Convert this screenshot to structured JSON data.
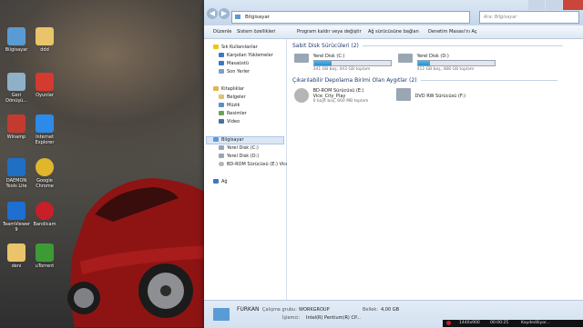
{
  "desktop": {
    "icons": [
      {
        "label": "Bilgisayar",
        "icon": "computer-icon",
        "color": "#5b9bd5"
      },
      {
        "label": "ddd",
        "icon": "folder-icon",
        "color": "#e9c46a"
      },
      {
        "label": "Geri Dönüşü...",
        "icon": "recycle-bin-icon",
        "color": "#8fb0c9"
      },
      {
        "label": "Oyunlar",
        "icon": "games-icon",
        "color": "#d43a2f"
      },
      {
        "label": "Winamp",
        "icon": "winamp-icon",
        "color": "#c53a2f"
      },
      {
        "label": "Internet Explorer",
        "icon": "internet-explorer-icon",
        "color": "#2c8be8"
      },
      {
        "label": "DAEMON Tools Lite",
        "icon": "daemon-tools-icon",
        "color": "#1f6fc4"
      },
      {
        "label": "Google Chrome",
        "icon": "chrome-icon",
        "color": "#e0b62d"
      },
      {
        "label": "TeamViewer 9",
        "icon": "teamviewer-icon",
        "color": "#1d6fd1"
      },
      {
        "label": "Bandicam",
        "icon": "bandicam-icon",
        "color": "#c81f2a"
      },
      {
        "label": "deni",
        "icon": "folder-icon",
        "color": "#e9c46a"
      },
      {
        "label": "uTorrent",
        "icon": "utorrent-icon",
        "color": "#3d9b35"
      }
    ]
  },
  "window": {
    "address": "Bilgisayar",
    "search_placeholder": "Ara: Bilgisayar",
    "toolbar": [
      "Düzenle",
      "Sistem özellikleri",
      "Program kaldır veya değiştir",
      "Ağ sürücüsüne bağlan",
      "Denetim Masası'nı Aç"
    ],
    "nav": {
      "favorites": {
        "label": "Sık Kullanılanlar",
        "items": [
          "Karşıdan Yüklemeler",
          "Masaüstü",
          "Son Yerler"
        ]
      },
      "libraries": {
        "label": "Kitaplıklar",
        "items": [
          "Belgeler",
          "Müzik",
          "Resimler",
          "Video"
        ]
      },
      "computer": {
        "label": "Bilgisayar",
        "items": [
          "Yerel Disk (C:)",
          "Yerel Disk (D:)",
          "BD-ROM Sürücüsü (E:) Vice"
        ]
      },
      "network": {
        "label": "Ağ"
      }
    },
    "groups": {
      "hdd": {
        "title": "Sabit Disk Sürücüleri (2)"
      },
      "removable": {
        "title": "Çıkarılabilir Depolama Birimi Olan Aygıtlar (2)"
      }
    },
    "drives": {
      "c": {
        "name": "Yerel Disk (C:)",
        "free": "341 GB boş, 443 GB toplam",
        "used_fraction": 0.23
      },
      "d": {
        "name": "Yerel Disk (D:)",
        "free": "411 GB boş, 488 GB toplam",
        "used_fraction": 0.16
      },
      "e": {
        "name": "BD-ROM Sürücüsü (E:)",
        "label": "Vice_City_Play",
        "free": "0 bayt boş, 660 MB toplam"
      },
      "f": {
        "name": "DVD RW Sürücüsü (F:)"
      }
    },
    "details": {
      "name": "FURKAN",
      "workgroup_label": "Çalışma grubu:",
      "workgroup": "WORKGROUP",
      "memory_label": "Bellek:",
      "memory": "4,00 GB",
      "cpu_label": "İşlemci:",
      "cpu": "Intel(R) Pentium(R) CP..."
    }
  },
  "taskbar": {
    "resolution": "1440x900",
    "timer": "00:00:25",
    "status": "Kaydediliyor..."
  }
}
